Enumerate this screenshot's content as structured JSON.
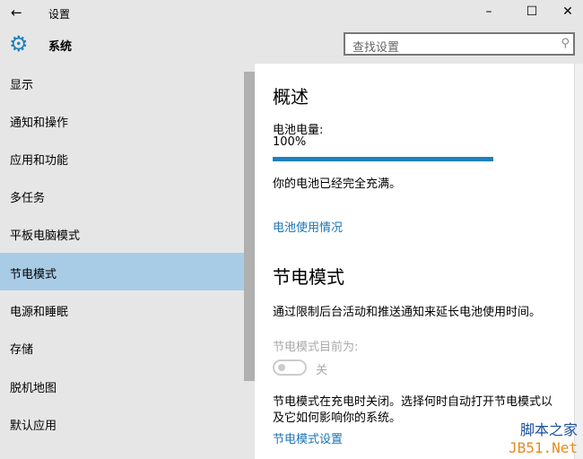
{
  "window": {
    "title": "设置",
    "minimize": "–",
    "maximize": "☐",
    "close": "✕",
    "back": "←"
  },
  "header": {
    "section": "系统",
    "search_placeholder": "查找设置"
  },
  "sidebar": {
    "items": [
      {
        "label": "显示"
      },
      {
        "label": "通知和操作"
      },
      {
        "label": "应用和功能"
      },
      {
        "label": "多任务"
      },
      {
        "label": "平板电脑模式"
      },
      {
        "label": "节电模式",
        "selected": true
      },
      {
        "label": "电源和睡眠"
      },
      {
        "label": "存储"
      },
      {
        "label": "脱机地图"
      },
      {
        "label": "默认应用"
      }
    ]
  },
  "main": {
    "overview_title": "概述",
    "battery_label": "电池电量:",
    "battery_value": "100%",
    "battery_percent": 100,
    "battery_status": "你的电池已经完全充满。",
    "battery_usage_link": "电池使用情况",
    "saver_title": "节电模式",
    "saver_desc": "通过限制后台活动和推送通知来延长电池使用时间。",
    "saver_current_label": "节电模式目前为:",
    "toggle_state": "关",
    "saver_note_1": "节电模式在充电时关闭。选择何时自动打开节电模式以",
    "saver_note_2": "及它如何影响你的系统。",
    "saver_settings_link": "节电模式设置"
  },
  "watermark": {
    "line1": "脚本之家",
    "line2": "JB51.Net"
  },
  "colors": {
    "accent": "#1e80c0",
    "selected": "#a9cce6"
  }
}
